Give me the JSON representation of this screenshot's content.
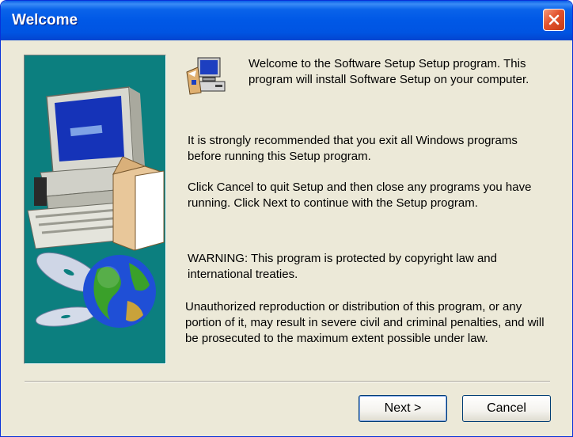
{
  "window": {
    "title": "Welcome"
  },
  "content": {
    "intro": "Welcome to the Software Setup Setup program.  This program will install Software Setup on your computer.",
    "recommend": "It is strongly recommended that you exit all Windows programs before running this Setup program.",
    "instructions": "Click Cancel to quit Setup and then close any programs you have running.  Click Next to continue with the Setup program.",
    "warning": "WARNING: This program is protected by copyright law and international treaties.",
    "penalties": "Unauthorized reproduction or distribution of this program, or any portion of it, may result in severe civil and criminal penalties, and will be prosecuted to the maximum extent possible under law."
  },
  "buttons": {
    "next": "Next >",
    "cancel": "Cancel"
  },
  "icons": {
    "close": "close-icon",
    "setup": "setup-computer-icon",
    "side_image": "computer-cd-globe-illustration"
  },
  "colors": {
    "titlebar": "#0054e2",
    "dialog_background": "#ece9d8",
    "side_panel": "#0c7f7f",
    "close_button": "#e2522d"
  }
}
